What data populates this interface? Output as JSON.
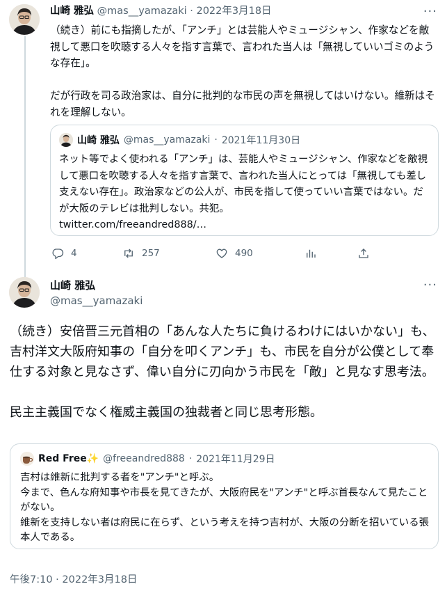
{
  "tweet1": {
    "author_name": "山崎 雅弘",
    "author_handle": "@mas__yamazaki",
    "separator": "·",
    "date": "2022年3月18日",
    "text": "（続き）前にも指摘したが、「アンチ」とは芸能人やミュージシャン、作家などを敵視して悪口を吹聴する人々を指す言葉で、言われた当人は「無視していいゴミのような存在」。\n\nだが行政を司る政治家は、自分に批判的な市民の声を無視してはいけない。維新はそれを理解しない。",
    "quote": {
      "author_name": "山崎 雅弘",
      "author_handle": "@mas__yamazaki",
      "separator": "·",
      "date": "2021年11月30日",
      "text": "ネット等でよく使われる「アンチ」は、芸能人やミュージシャン、作家などを敵視して悪口を吹聴する人々を指す言葉で、言われた当人にとっては「無視しても差し支えない存在」。政治家などの公人が、市民を指して使っていい言葉ではない。だが大阪のテレビは批判しない。共犯。\ntwitter.com/freeandred888/…"
    },
    "actions": {
      "reply_icon": "reply-icon",
      "reply_count": "4",
      "retweet_icon": "retweet-icon",
      "retweet_count": "257",
      "like_icon": "heart-icon",
      "like_count": "490",
      "stats_icon": "bar-chart-icon",
      "share_icon": "share-icon"
    }
  },
  "tweet2": {
    "author_name": "山崎 雅弘",
    "author_handle": "@mas__yamazaki",
    "more_label": "···",
    "text": "（続き）安倍晋三元首相の「あんな人たちに負けるわけにはいかない」も、吉村洋文大阪府知事の「自分を叩くアンチ」も、市民を自分が公僕として奉仕する対象と見なさず、偉い自分に刃向かう市民を「敵」と見なす思考法。\n\n民主主義国でなく権威主義国の独裁者と同じ思考形態。",
    "quote": {
      "author_name": "Red Free✨",
      "author_handle": "@freeandred888",
      "separator": "·",
      "date": "2021年11月29日",
      "text": "吉村は維新に批判する者を\"アンチ\"と呼ぶ。\n今まで、色んな府知事や市長を見てきたが、大阪府民を\"アンチ\"と呼ぶ首長なんて見たことがない。\n維新を支持しない者は府民に在らず、という考えを持つ吉村が、大阪の分断を招いている張本人である。"
    },
    "timestamp": "午後7:10 · 2022年3月18日"
  },
  "more_label": "···",
  "colors": {
    "text": "#0f1419",
    "muted": "#536471",
    "border": "#cfd9de"
  }
}
